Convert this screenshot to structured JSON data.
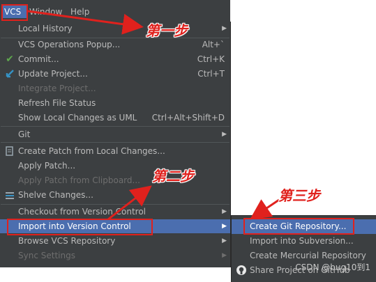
{
  "menubar": {
    "vcs": "VCS",
    "window": "Window",
    "help": "Help"
  },
  "menu": {
    "local_history": "Local History",
    "operations_popup": "VCS Operations Popup...",
    "operations_popup_shortcut": "Alt+`",
    "commit": "Commit...",
    "commit_shortcut": "Ctrl+K",
    "update_project": "Update Project...",
    "update_project_shortcut": "Ctrl+T",
    "integrate_project": "Integrate Project...",
    "refresh_file_status": "Refresh File Status",
    "show_local_changes": "Show Local Changes as UML",
    "show_local_changes_shortcut": "Ctrl+Alt+Shift+D",
    "git": "Git",
    "create_patch": "Create Patch from Local Changes...",
    "apply_patch": "Apply Patch...",
    "apply_patch_clipboard": "Apply Patch from Clipboard...",
    "shelve_changes": "Shelve Changes...",
    "checkout": "Checkout from Version Control",
    "import_vc": "Import into Version Control",
    "browse_repo": "Browse VCS Repository",
    "sync_settings": "Sync Settings"
  },
  "submenu": {
    "create_git": "Create Git Repository...",
    "import_svn": "Import into Subversion...",
    "create_hg": "Create Mercurial Repository",
    "share_project": "Share Project on GitHub"
  },
  "annotations": {
    "step1": "第一步",
    "step2": "第二步",
    "step3": "第三步"
  },
  "watermark": "CSDN @bug10到1",
  "colors": {
    "menu_bg": "#3c3f41",
    "selection": "#4b6eaf",
    "annotation_red": "#e0211d",
    "disabled_text": "#6e6e6e"
  }
}
